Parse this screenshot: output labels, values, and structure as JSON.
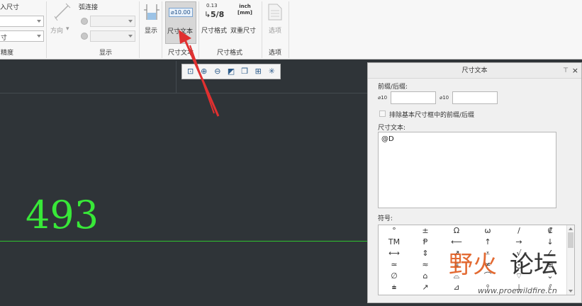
{
  "ribbon": {
    "left_group": {
      "top_label": "入尺寸",
      "combo2_value": "寸",
      "group_label": "精度"
    },
    "display_group": {
      "direction_label": "方向",
      "arc_label": "弧连接",
      "show_label": "显示",
      "group_label": "显示"
    },
    "dim_text_group": {
      "icon_text": "⌀10.00",
      "button_label": "尺寸文本",
      "group_label": "尺寸文本"
    },
    "dim_format_group": {
      "format_icon_text": "0.13",
      "fraction_text": "5/8",
      "format_label": "尺寸格式",
      "dual_icon_text": "inch\n[mm]",
      "dual_label": "双重尺寸",
      "group_label": "尺寸格式"
    },
    "options_group": {
      "button_label": "选项",
      "group_label": "选项"
    }
  },
  "canvas": {
    "dimension_value": "493"
  },
  "panel": {
    "title": "尺寸文本",
    "prefix_suffix_label": "前缀/后缀:",
    "prefix_icon": "⌀10",
    "suffix_icon": "⌀10",
    "exclude_label": "排除基本尺寸框中的前缀/后缀",
    "dim_text_label": "尺寸文本:",
    "dim_text_value": "@D",
    "symbols_label": "符号:",
    "symbols": [
      "°",
      "±",
      "Ω",
      "ω",
      "/",
      "₡",
      "TM",
      "Ᵽ",
      "⟵",
      "↑",
      "→",
      "↓",
      "⟷",
      "⇕",
      "↗",
      "⩡",
      "√",
      "∠",
      "≃",
      "≈",
      "⩰",
      "≠",
      "⨀",
      "⊕",
      "∅",
      "⌂",
      "⌓",
      "⌒",
      "⌔",
      "⌄",
      "⩧",
      "↗",
      "⊿",
      "⫯",
      "⊥",
      "⫽"
    ]
  },
  "watermark": {
    "text_a": "野火",
    "text_b": "论坛",
    "url": "www.proewildfire.cn"
  }
}
